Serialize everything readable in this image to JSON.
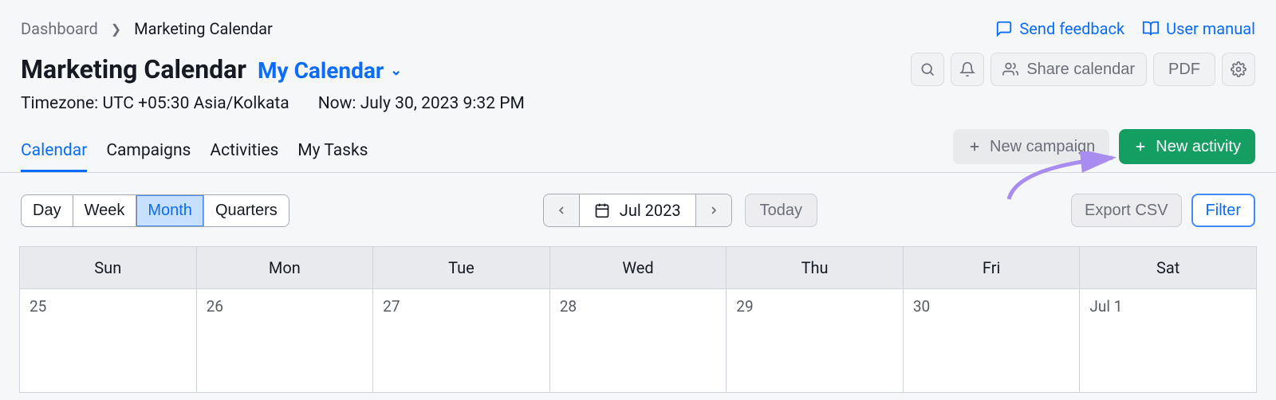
{
  "breadcrumb": {
    "root": "Dashboard",
    "current": "Marketing Calendar"
  },
  "top_links": {
    "feedback": "Send feedback",
    "manual": "User manual"
  },
  "header": {
    "title": "Marketing Calendar",
    "calendar_name": "My Calendar",
    "timezone": "Timezone: UTC +05:30 Asia/Kolkata",
    "now": "Now: July 30, 2023 9:32 PM"
  },
  "title_actions": {
    "share": "Share calendar",
    "pdf": "PDF"
  },
  "tabs": [
    "Calendar",
    "Campaigns",
    "Activities",
    "My Tasks"
  ],
  "tabs_active": 0,
  "tab_actions": {
    "new_campaign": "New campaign",
    "new_activity": "New activity"
  },
  "toolbar": {
    "views": [
      "Day",
      "Week",
      "Month",
      "Quarters"
    ],
    "view_active": 2,
    "date_label": "Jul 2023",
    "today": "Today",
    "export": "Export CSV",
    "filter": "Filter"
  },
  "calendar": {
    "weekdays": [
      "Sun",
      "Mon",
      "Tue",
      "Wed",
      "Thu",
      "Fri",
      "Sat"
    ],
    "row0": [
      "25",
      "26",
      "27",
      "28",
      "29",
      "30",
      "Jul 1"
    ]
  }
}
